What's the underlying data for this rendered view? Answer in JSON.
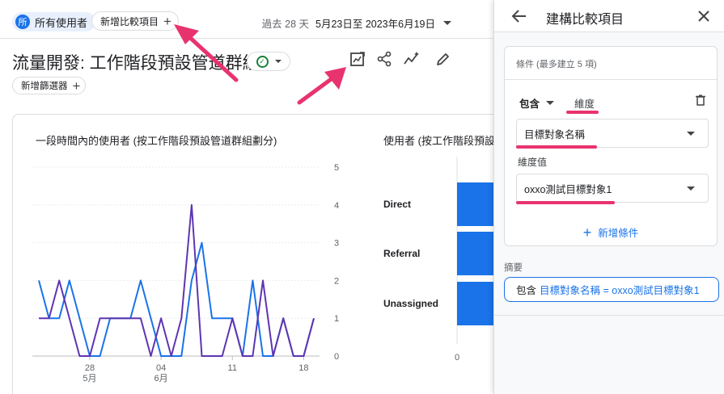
{
  "header": {
    "segment_avatar": "所",
    "segment_label": "所有使用者",
    "add_comparison_label": "新增比較項目",
    "date_prefix": "過去 28 天",
    "date_range": "5月23日至 2023年6月19日"
  },
  "report": {
    "title": "流量開發: 工作階段預設管道群組",
    "add_filter_label": "新增篩選器",
    "toolbar_icons": [
      "edit-report-icon",
      "share-icon",
      "insights-icon",
      "pencil-icon"
    ]
  },
  "charts": {
    "line_title": "一段時間內的使用者 (按工作階段預設管道群組劃分)",
    "bar_title": "使用者 (按工作階段預設管道群組劃分)"
  },
  "chart_data": [
    {
      "type": "line",
      "title": "一段時間內的使用者 (按工作階段預設管道群組劃分)",
      "x_ticks": [
        {
          "label": "28",
          "sub": "5月",
          "index": 5
        },
        {
          "label": "04",
          "sub": "6月",
          "index": 12
        },
        {
          "label": "11",
          "sub": "",
          "index": 19
        },
        {
          "label": "18",
          "sub": "",
          "index": 26
        }
      ],
      "y_ticks": [
        0,
        1,
        2,
        3,
        4,
        5
      ],
      "ylim": [
        0,
        5
      ],
      "series": [
        {
          "color": "#1a73e8",
          "values": [
            2,
            1,
            1,
            2,
            1,
            0,
            0,
            1,
            1,
            1,
            2,
            1,
            0,
            0,
            0,
            2,
            3,
            1,
            1,
            1,
            0,
            2,
            0,
            0,
            1,
            0,
            0,
            1
          ]
        },
        {
          "color": "#5e35b1",
          "values": [
            1,
            1,
            2,
            1,
            0,
            0,
            1,
            1,
            1,
            1,
            1,
            0,
            1,
            0,
            1,
            4,
            0,
            0,
            0,
            1,
            0,
            0,
            2,
            0,
            1,
            0,
            0,
            1
          ]
        }
      ]
    },
    {
      "type": "bar",
      "title": "使用者 (按工作階段預設管道群組劃分)",
      "categories": [
        "Direct",
        "Referral",
        "Unassigned"
      ],
      "x_ticks": [
        0
      ],
      "color": "#1a73e8"
    }
  ],
  "panel": {
    "title": "建構比較項目",
    "condition_limit": "條件 (最多建立 5 項)",
    "include_label": "包含",
    "dimension_label": "維度",
    "dimension_value": "目標對象名稱",
    "dimension_value_label": "維度值",
    "dimension_value_value": "oxxo測試目標對象1",
    "add_condition_label": "新增條件",
    "summary_label": "摘要",
    "summary_keyword": "包含",
    "summary_expression": "目標對象名稱 = oxxo測試目標對象1"
  },
  "colors": {
    "accent": "#1a73e8",
    "highlight": "#e8336e",
    "line_blue": "#1a73e8",
    "line_purple": "#5e35b1"
  }
}
